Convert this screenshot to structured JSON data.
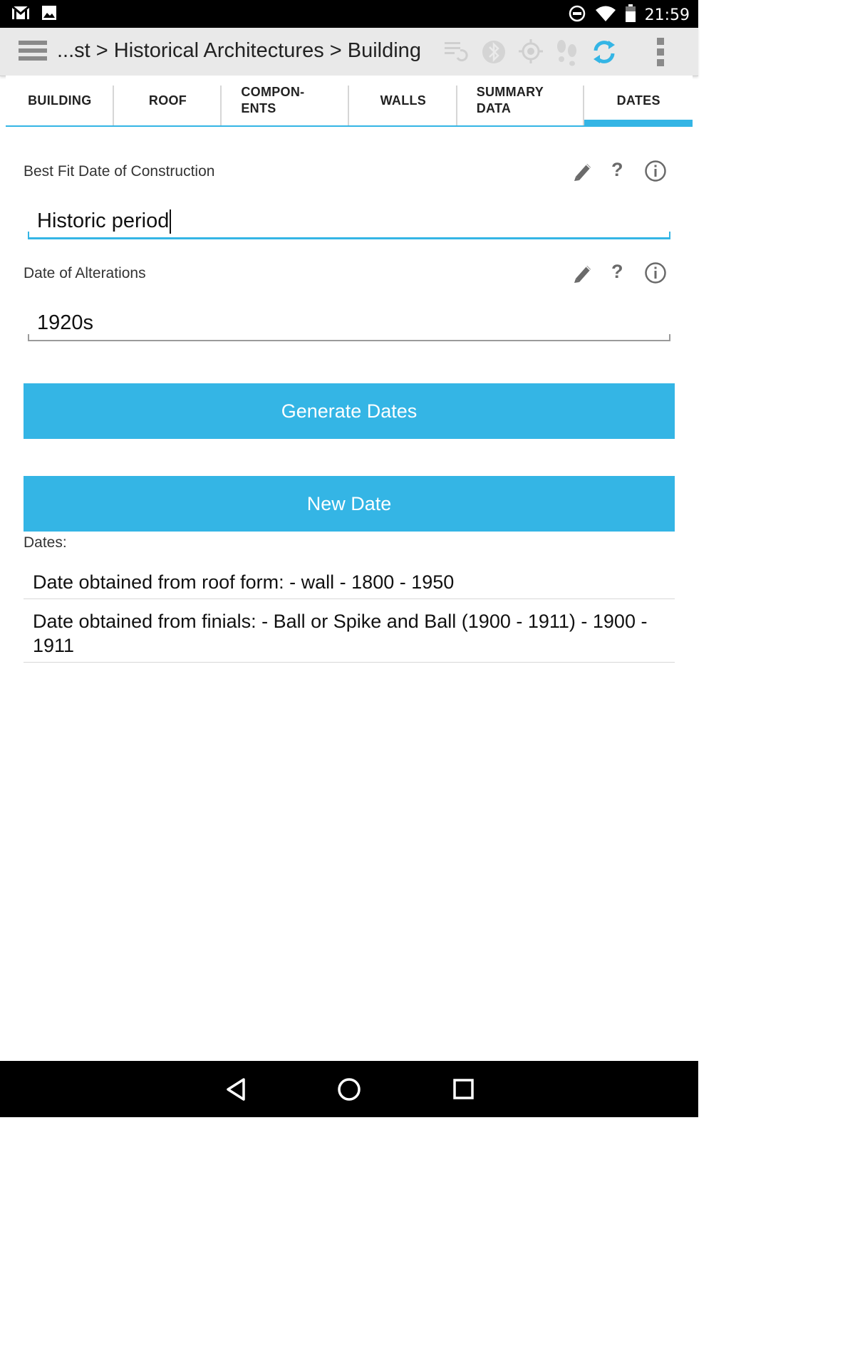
{
  "status_bar": {
    "time": "21:59",
    "left_icons": [
      "gmail-icon",
      "image-icon"
    ],
    "right_icons": [
      "do-not-disturb-icon",
      "wifi-icon",
      "battery-icon"
    ]
  },
  "action_bar": {
    "breadcrumb": "...st > Historical Architectures > Building",
    "icons": [
      "list-sync-icon",
      "bluetooth-icon",
      "gps-target-icon",
      "footsteps-icon",
      "sync-icon",
      "overflow-menu-icon"
    ],
    "accent_color": "#34b5e5"
  },
  "tabs": [
    {
      "label": "BUILDING"
    },
    {
      "label": "ROOF"
    },
    {
      "label_line1": "COMPON-",
      "label_line2": "ENTS"
    },
    {
      "label": "WALLS"
    },
    {
      "label_line1": "SUMMARY",
      "label_line2": "DATA"
    },
    {
      "label": "DATES",
      "active": true
    }
  ],
  "fields": {
    "construction": {
      "label": "Best Fit Date of Construction",
      "value": "Historic period"
    },
    "alterations": {
      "label": "Date of Alterations",
      "value": "1920s"
    }
  },
  "buttons": {
    "generate_dates": "Generate Dates",
    "new_date": "New Date"
  },
  "dates": {
    "label": "Dates:",
    "items": [
      "Date obtained from roof form: - wall - 1800 - 1950",
      "Date obtained from finials: - Ball or Spike and Ball (1900 - 1911) - 1900 - 1911"
    ]
  },
  "nav_bar": {
    "icons": [
      "back-icon",
      "home-icon",
      "recents-icon"
    ]
  }
}
